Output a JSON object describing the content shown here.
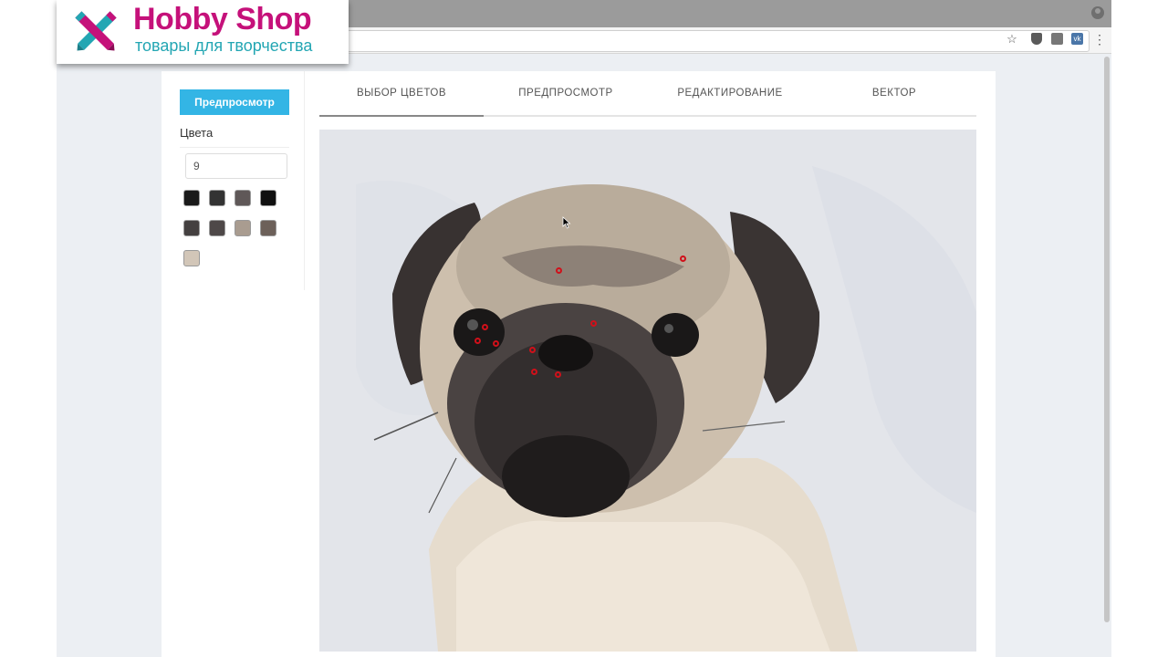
{
  "logo": {
    "title": "Hobby Shop",
    "subtitle": "товары для творчества",
    "colors": {
      "title": "#c5117a",
      "subtitle": "#23a6b3",
      "pencil_blue": "#23a6b3",
      "pencil_pink": "#c5117a"
    }
  },
  "browser": {
    "icons": [
      "profile-icon",
      "star-icon",
      "shield-icon",
      "extension-icon",
      "vk-icon",
      "menu-icon"
    ],
    "vk_label": "vk",
    "star_glyph": "☆",
    "menu_glyph": "⋮"
  },
  "sidebar": {
    "preview_button": "Предпросмотр",
    "colors_label": "Цвета",
    "colors_count": "9",
    "swatches": [
      "#1a1a1a",
      "#333333",
      "#5f5858",
      "#101010",
      "#444040",
      "#4e4848",
      "#a99c90",
      "#6c6059",
      "#d2c6b8"
    ]
  },
  "tabs": [
    {
      "label": "ВЫБОР ЦВЕТОВ",
      "active": true
    },
    {
      "label": "ПРЕДПРОСМОТР",
      "active": false
    },
    {
      "label": "РЕДАКТИРОВАНИЕ",
      "active": false
    },
    {
      "label": "ВЕКТОР",
      "active": false
    }
  ],
  "accent_color": "#33b5e5",
  "marker_color": "#d0101a"
}
